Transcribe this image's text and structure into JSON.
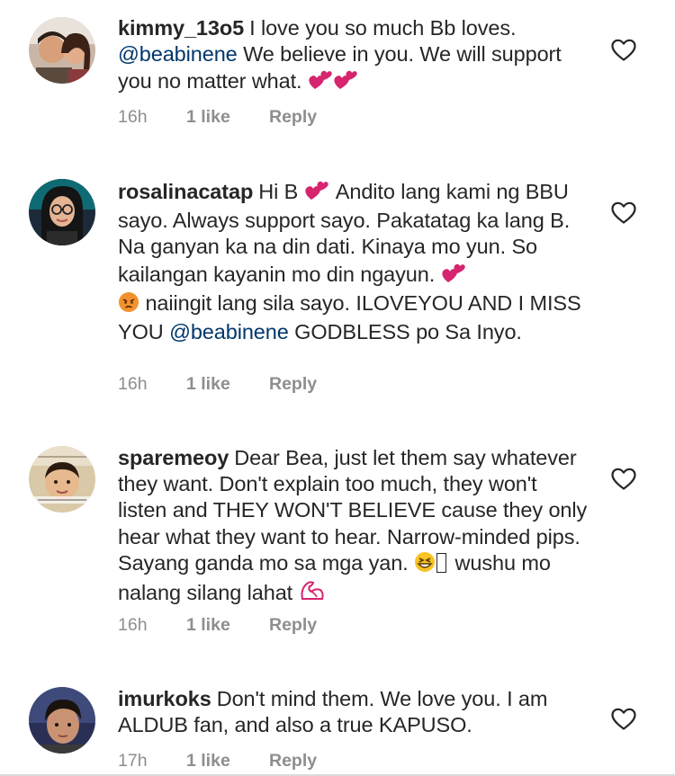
{
  "comments": [
    {
      "username": "kimmy_13o5",
      "text_1": "I love you so much Bb loves.",
      "mention": "@beabinene",
      "text_2": "We believe in you. We will support you no matter what.",
      "time": "16h",
      "likes": "1 like",
      "reply": "Reply",
      "avatar_icon": "couple-photo"
    },
    {
      "username": "rosalinacatap",
      "text_1": "Hi B",
      "text_2": "Andito lang kami ng BBU sayo. Always support sayo.  Pakatatag ka lang B. Na ganyan ka na din dati. Kinaya mo yun. So kailangan kayanin mo din ngayun.",
      "text_3": "naiingit lang sila sayo. ILOVEYOU AND I MISS YOU",
      "mention": "@beabinene",
      "text_4": "GODBLESS po Sa Inyo.",
      "time": "16h",
      "likes": "1 like",
      "reply": "Reply",
      "avatar_icon": "woman-with-glasses-photo"
    },
    {
      "username": "sparemeoy",
      "text_1": "Dear Bea, just let them say whatever they want. Don't explain too much, they won't listen and THEY WON'T BELIEVE cause they only hear what they want to hear. Narrow-minded pips. Sayang ganda mo sa mga yan.",
      "text_2": "wushu mo nalang silang lahat",
      "time": "16h",
      "likes": "1 like",
      "reply": "Reply",
      "avatar_icon": "child-photo"
    },
    {
      "username": "imurkoks",
      "text_1": "Don't mind them. We love you. I am ALDUB fan, and also a true KAPUSO.",
      "time": "17h",
      "likes": "1 like",
      "reply": "Reply",
      "avatar_icon": "young-man-photo"
    }
  ],
  "icons": {
    "like": "heart-outline-icon",
    "emoji_hearts": "two-hearts-emoji",
    "emoji_pouting": "pouting-face-emoji",
    "emoji_grin": "grinning-squinting-face-emoji",
    "emoji_muscle": "flexed-biceps-emoji"
  },
  "colors": {
    "text": "#262626",
    "secondary": "#8e8e8e",
    "mention": "#00376b",
    "hearts_emoji": "#d6246e"
  }
}
